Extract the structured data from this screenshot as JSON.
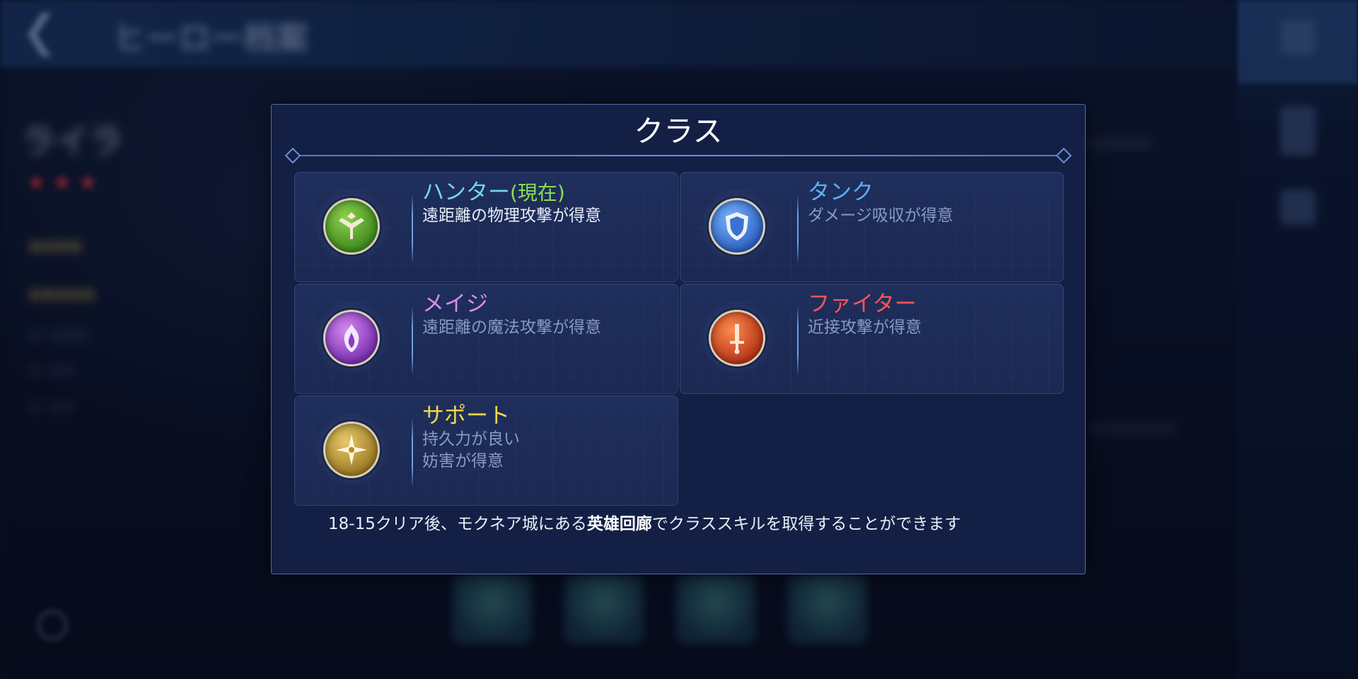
{
  "modal": {
    "title": "クラス",
    "classes": [
      {
        "name": "ハンター",
        "current_tag": "(現在)",
        "desc_lines": [
          "遠距離の物理攻撃が得意"
        ],
        "color": "#6fd8e6",
        "icon": "hunter-bow-icon"
      },
      {
        "name": "タンク",
        "current_tag": "",
        "desc_lines": [
          "ダメージ吸収が得意"
        ],
        "color": "#5ab0f0",
        "icon": "tank-shield-icon"
      },
      {
        "name": "メイジ",
        "current_tag": "",
        "desc_lines": [
          "遠距離の魔法攻撃が得意"
        ],
        "color": "#d98bef",
        "icon": "mage-flame-icon"
      },
      {
        "name": "ファイター",
        "current_tag": "",
        "desc_lines": [
          "近接攻撃が得意"
        ],
        "color": "#ff5457",
        "icon": "fighter-sword-icon"
      },
      {
        "name": "サポート",
        "current_tag": "",
        "desc_lines": [
          "持久力が良い",
          "妨害が得意"
        ],
        "color": "#f4d64b",
        "icon": "support-star-icon"
      }
    ],
    "note": {
      "before": "18-15クリア後、モクネア城にある",
      "highlight": "英雄回廊",
      "after": "でクラススキルを取得することができます"
    }
  },
  "background": {
    "page_title": "ヒーロー档案",
    "hero_name": "ライラ"
  }
}
